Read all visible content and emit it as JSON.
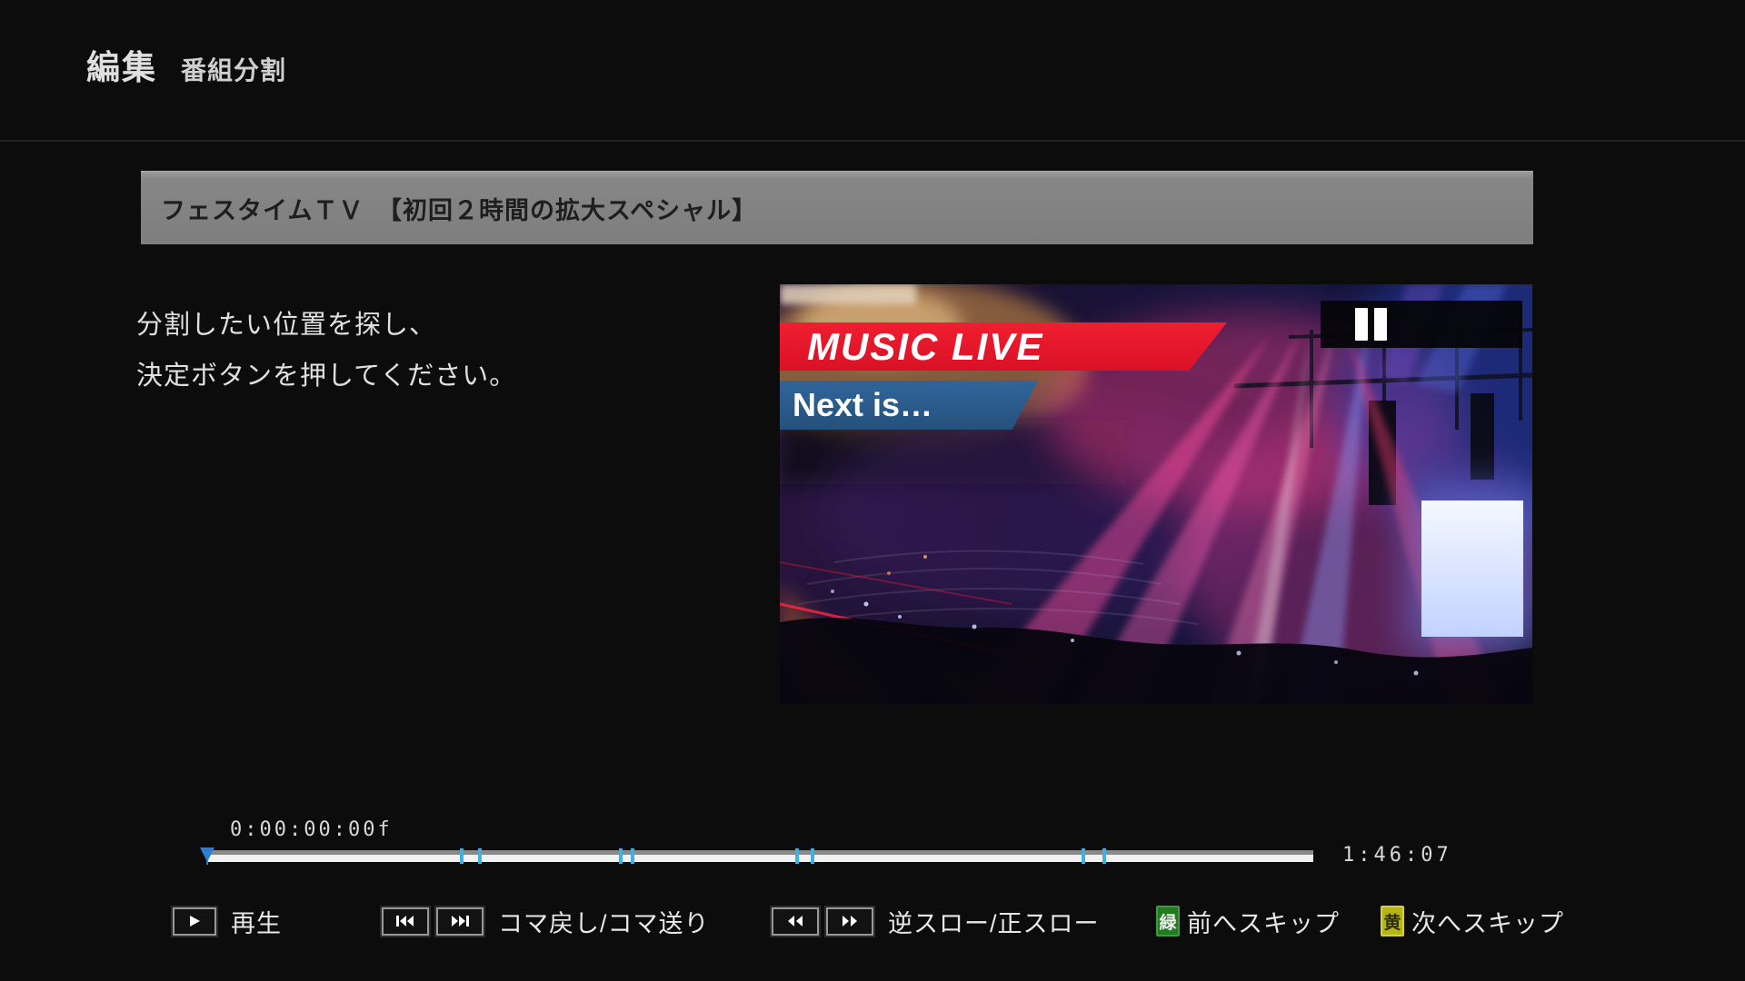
{
  "header": {
    "title": "編集",
    "section": "番組分割"
  },
  "program_bar": {
    "title": "フェスタイムＴＶ　【初回２時間の拡大スペシャル】"
  },
  "instructions": {
    "line1": "分割したい位置を探し、",
    "line2": "決定ボタンを押してください。"
  },
  "video": {
    "state": "paused",
    "overlay_banner_primary": "MUSIC LIVE",
    "overlay_banner_secondary": "Next is…",
    "banner_primary_color": "#e8192c",
    "banner_secondary_color": "#2c5d8f",
    "pause_icon": "pause-icon"
  },
  "timeline": {
    "current_timecode": "0:00:00:00f",
    "total_duration": "1:46:07",
    "playhead_position_pct": 0,
    "marker_color": "#3fb0e0",
    "markers_pct": [
      23.1,
      24.7,
      37.4,
      38.5,
      53.4,
      54.8,
      79.2,
      81.1
    ]
  },
  "controls": {
    "groups": [
      {
        "icons": [
          "play"
        ],
        "label": "再生"
      },
      {
        "icons": [
          "frame-back",
          "frame-forward"
        ],
        "label": "コマ戻し/コマ送り"
      },
      {
        "icons": [
          "rewind",
          "fast-forward"
        ],
        "label": "逆スロー/正スロー"
      },
      {
        "badge": {
          "text": "緑",
          "color": "#237a23"
        },
        "label": "前へスキップ"
      },
      {
        "badge": {
          "text": "黄",
          "color": "#b5b518"
        },
        "label": "次へスキップ"
      }
    ]
  }
}
